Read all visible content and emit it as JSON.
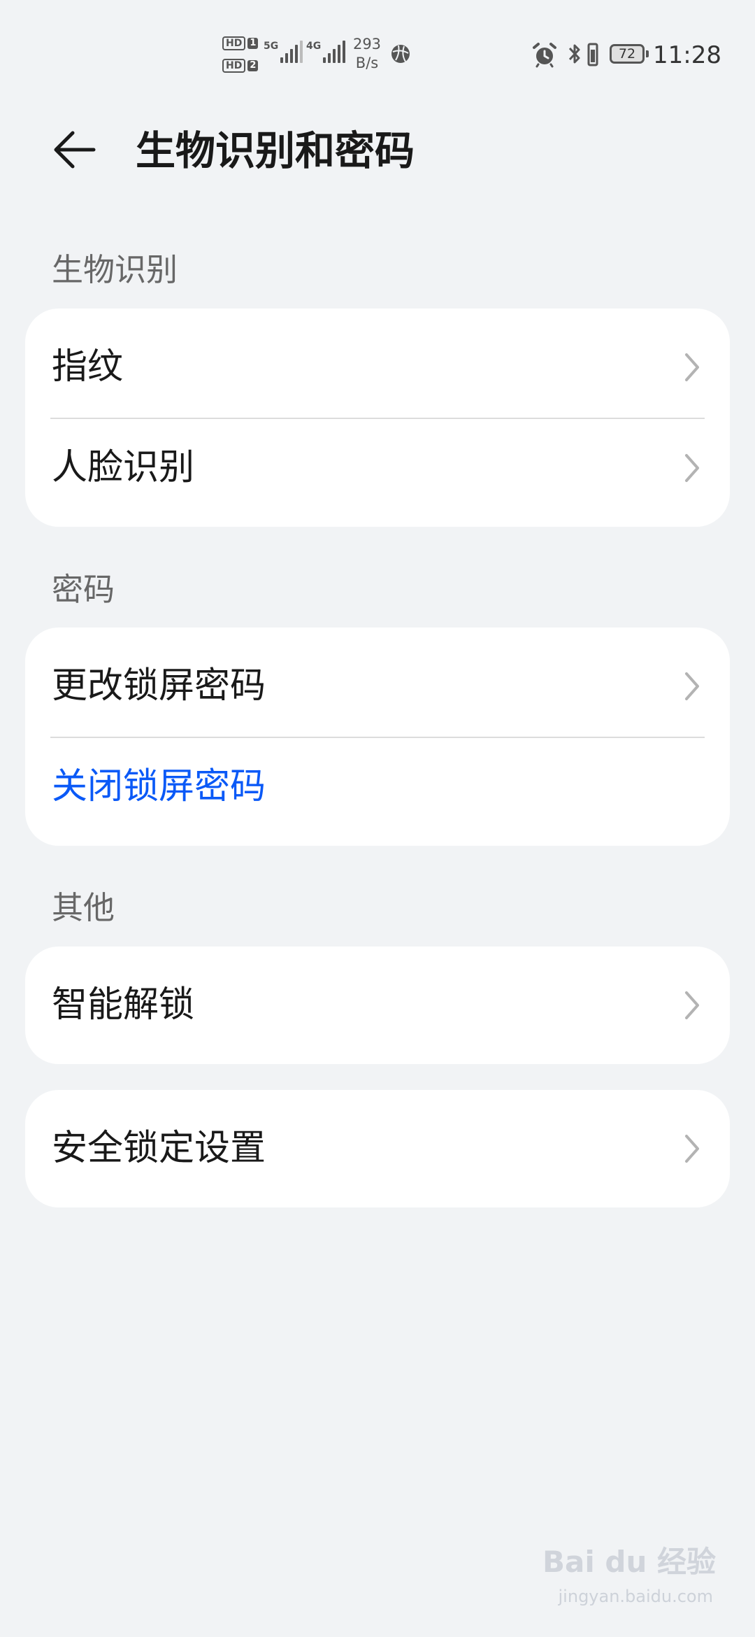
{
  "status_bar": {
    "hd1": "HD",
    "hd1_num": "1",
    "hd2": "HD",
    "hd2_num": "2",
    "sim1_network": "5G",
    "sim2_network": "4G",
    "speed_value": "293",
    "speed_unit": "B/s",
    "battery_level": "72",
    "time": "11:28",
    "icons": [
      "hd-icon",
      "signal-icon",
      "globe-icon",
      "alarm-icon",
      "bluetooth-icon",
      "vibrate-icon",
      "battery-icon"
    ]
  },
  "header": {
    "title": "生物识别和密码",
    "back_icon": "back-arrow-icon"
  },
  "sections": {
    "biometrics": {
      "label": "生物识别",
      "items": [
        {
          "label": "指纹"
        },
        {
          "label": "人脸识别"
        }
      ]
    },
    "password": {
      "label": "密码",
      "items": [
        {
          "label": "更改锁屏密码"
        },
        {
          "label": "关闭锁屏密码"
        }
      ]
    },
    "other": {
      "label": "其他",
      "items": [
        {
          "label": "智能解锁"
        }
      ]
    },
    "security_lock": {
      "items": [
        {
          "label": "安全锁定设置"
        }
      ]
    }
  },
  "colors": {
    "background": "#f1f3f5",
    "card": "#ffffff",
    "text": "#191919",
    "section_label": "#676767",
    "accent": "#0a59f7",
    "chevron": "#b3b3b3"
  },
  "watermark": {
    "brand": "Bai du 经验",
    "url": "jingyan.baidu.com"
  }
}
